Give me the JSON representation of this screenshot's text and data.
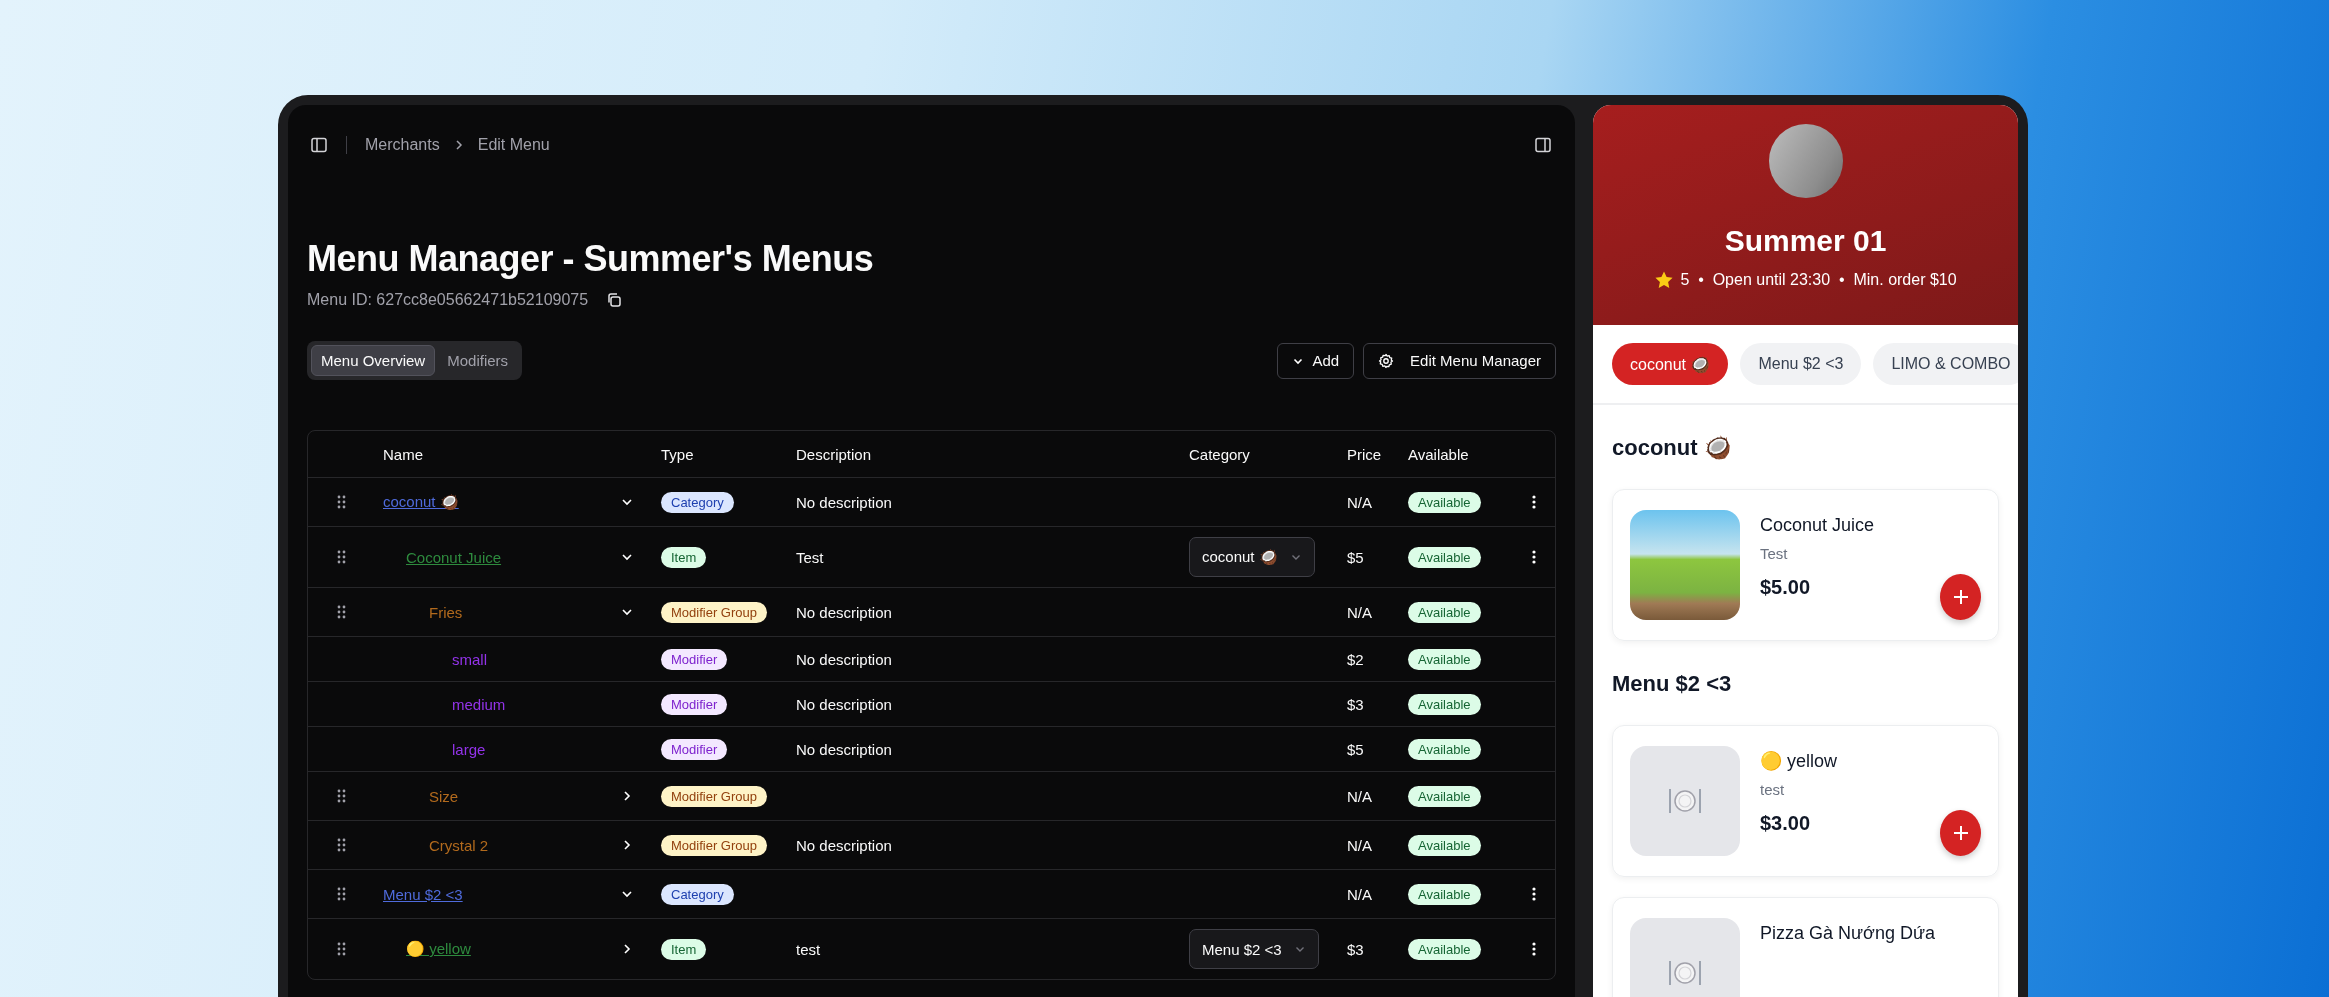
{
  "topbar": {
    "breadcrumbs": [
      "Merchants",
      "Edit Menu"
    ]
  },
  "page": {
    "title": "Menu Manager - Summer's Menus",
    "menu_id": "Menu ID: 627cc8e05662471b52109075"
  },
  "tabs": [
    {
      "label": "Menu Overview",
      "selected": true
    },
    {
      "label": "Modifiers",
      "selected": false
    }
  ],
  "actions": {
    "add": "Add",
    "edit": "Edit Menu Manager"
  },
  "table": {
    "columns": [
      "Name",
      "Type",
      "Description",
      "Category",
      "Price",
      "Available"
    ],
    "rows": [
      {
        "name": "coconut 🥥",
        "kind": "category",
        "type": "Category",
        "expanded": true,
        "description": "No description",
        "price": "N/A",
        "status": "Available",
        "children": [
          {
            "name": "Coconut Juice",
            "kind": "item",
            "type": "Item",
            "expanded": true,
            "description": "Test",
            "category": "coconut 🥥",
            "price": "$5",
            "status": "Available",
            "children": [
              {
                "name": "Fries",
                "kind": "modifier_group",
                "type": "Modifier Group",
                "expanded": true,
                "description": "No description",
                "price": "N/A",
                "status": "Available",
                "children": [
                  {
                    "name": "small",
                    "kind": "modifier",
                    "type": "Modifier",
                    "description": "No description",
                    "price": "$2",
                    "status": "Available"
                  },
                  {
                    "name": "medium",
                    "kind": "modifier",
                    "type": "Modifier",
                    "description": "No description",
                    "price": "$3",
                    "status": "Available"
                  },
                  {
                    "name": "large",
                    "kind": "modifier",
                    "type": "Modifier",
                    "description": "No description",
                    "price": "$5",
                    "status": "Available"
                  }
                ]
              },
              {
                "name": "Size",
                "kind": "modifier_group",
                "type": "Modifier Group",
                "expanded": false,
                "price": "N/A",
                "status": "Available"
              },
              {
                "name": "Crystal 2",
                "kind": "modifier_group",
                "type": "Modifier Group",
                "expanded": false,
                "description": "No description",
                "price": "N/A",
                "status": "Available"
              }
            ]
          }
        ]
      },
      {
        "name": "Menu $2 <3",
        "kind": "category",
        "type": "Category",
        "expanded": true,
        "price": "N/A",
        "status": "Available",
        "children": [
          {
            "name": "🟡 yellow",
            "kind": "item",
            "type": "Item",
            "expanded": false,
            "description": "test",
            "category": "Menu $2 <3",
            "price": "$3",
            "status": "Available"
          }
        ]
      }
    ]
  },
  "preview": {
    "store": {
      "name": "Summer 01",
      "meta": "5  •  Open until 23:30  •  Min. order $10"
    },
    "chips": [
      {
        "label": "coconut 🥥",
        "selected": true
      },
      {
        "label": "Menu $2 <3",
        "selected": false
      },
      {
        "label": "LIMO & COMBO",
        "selected": false
      }
    ],
    "sections": [
      {
        "title": "coconut 🥥",
        "items": [
          {
            "name": "Coconut Juice",
            "description": "Test",
            "price": "$5.00",
            "kind": "with_photo"
          }
        ]
      },
      {
        "title": "Menu $2 <3",
        "items": [
          {
            "name": "🟡 yellow",
            "description": "test",
            "price": "$3.00",
            "kind": "no_photo"
          },
          {
            "name": "Pizza Gà Nướng Dứa",
            "kind": "no_photo"
          }
        ]
      }
    ]
  }
}
